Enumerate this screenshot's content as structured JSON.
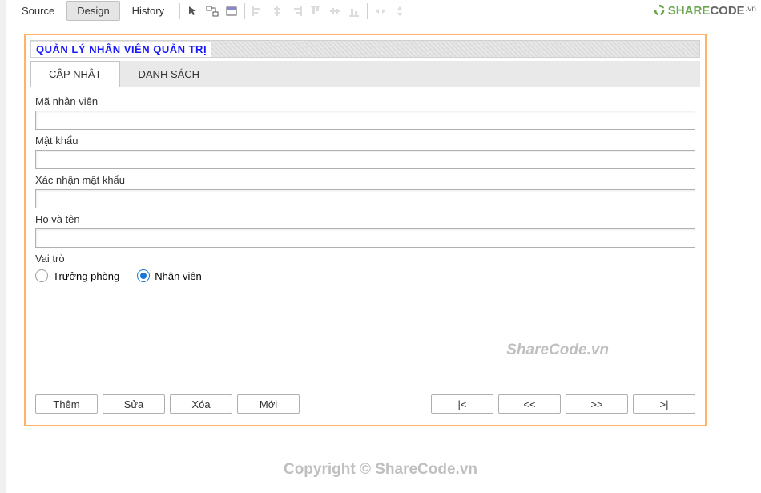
{
  "topbar": {
    "view_tabs": [
      "Source",
      "Design",
      "History"
    ],
    "active_view": "Design"
  },
  "logo": {
    "share": "SHARE",
    "code": "CODE",
    "vn": ".vn"
  },
  "panel": {
    "title": "QUẢN LÝ NHÂN VIÊN QUẢN TRỊ"
  },
  "tabs": {
    "items": [
      "CẬP NHẬT",
      "DANH SÁCH"
    ],
    "active": "CẬP NHẬT"
  },
  "form": {
    "ma_nhan_vien": {
      "label": "Mã nhân viên",
      "value": ""
    },
    "mat_khau": {
      "label": "Mật khẩu",
      "value": ""
    },
    "xac_nhan": {
      "label": "Xác nhận mật khẩu",
      "value": ""
    },
    "ho_ten": {
      "label": "Họ và tên",
      "value": ""
    },
    "vai_tro": {
      "label": "Vai trò",
      "options": [
        "Trưởng phòng",
        "Nhân viên"
      ],
      "selected": "Nhân viên"
    }
  },
  "buttons": {
    "crud": [
      "Thêm",
      "Sửa",
      "Xóa",
      "Mới"
    ],
    "nav": [
      "|<",
      "<<",
      ">>",
      ">|"
    ]
  },
  "watermark": "ShareCode.vn",
  "footer": "Copyright © ShareCode.vn"
}
